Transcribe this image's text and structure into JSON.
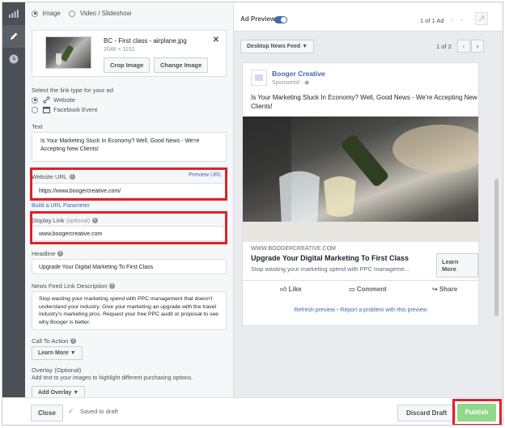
{
  "rail": {
    "icons": [
      "chart-icon",
      "pencil-icon",
      "clock-icon"
    ]
  },
  "format": {
    "image_label": "Image",
    "video_label": "Video / Slideshow"
  },
  "media": {
    "filename": "BC - First class - airplane.jpg",
    "dimensions": "2048 × 1152",
    "crop_label": "Crop Image",
    "change_label": "Change Image"
  },
  "link_type": {
    "label": "Select the link type for your ad",
    "website": "Website",
    "event": "Facebook Event"
  },
  "text_field": {
    "label": "Text",
    "value": "Is Your Marketing Stuck In Economy? Well, Good News - We're Accepting New Clients!"
  },
  "website_url": {
    "label": "Website URL",
    "preview_label": "Preview URL",
    "value": "https://www.boogercreative.com/"
  },
  "url_param_label": "Build a URL Parameter",
  "display_link": {
    "label": "Display Link",
    "optional": "(optional)",
    "value": "www.boogercreative.com"
  },
  "headline": {
    "label": "Headline",
    "value": "Upgrade Your Digital Marketing To First Class"
  },
  "description": {
    "label": "News Feed Link Description",
    "value": "Stop wasting your marketing spend with PPC management that doesn't understand your industry. Give your marketing an upgrade with the travel industry's marketing pros. Request your free PPC audit or proposal to see why Booger is better."
  },
  "cta": {
    "label": "Call To Action",
    "value": "Learn More"
  },
  "overlay": {
    "label": "Overlay",
    "optional": "(Optional)",
    "hint": "Add text to your images to highlight different purchasing options.",
    "button": "Add Overlay"
  },
  "preview": {
    "label": "Ad Preview",
    "ad_count": "1 of 1 Ad",
    "placement": "Desktop News Feed",
    "page_count": "1 of 2"
  },
  "ad": {
    "page_name": "Booger Creative",
    "sponsored": "Sponsored",
    "text": "Is Your Marketing Stuck In Economy? Well, Good News - We're Accepting New Clients!",
    "domain": "WWW.BOOGERCREATIVE.COM",
    "headline": "Upgrade Your Digital Marketing To First Class",
    "description": "Stop wasting your marketing spend with PPC manageme...",
    "cta": "Learn More",
    "like": "Like",
    "comment": "Comment",
    "share": "Share"
  },
  "preview_links": {
    "refresh": "Refresh preview",
    "separator": " • ",
    "report": "Report a problem with this preview"
  },
  "footer": {
    "close": "Close",
    "saved": "Saved to draft",
    "discard": "Discard Draft",
    "publish": "Publish"
  },
  "colors": {
    "accent": "#4267b2",
    "publish": "#91d88b",
    "highlight": "#e0202a",
    "rail": "#4b4f56"
  }
}
